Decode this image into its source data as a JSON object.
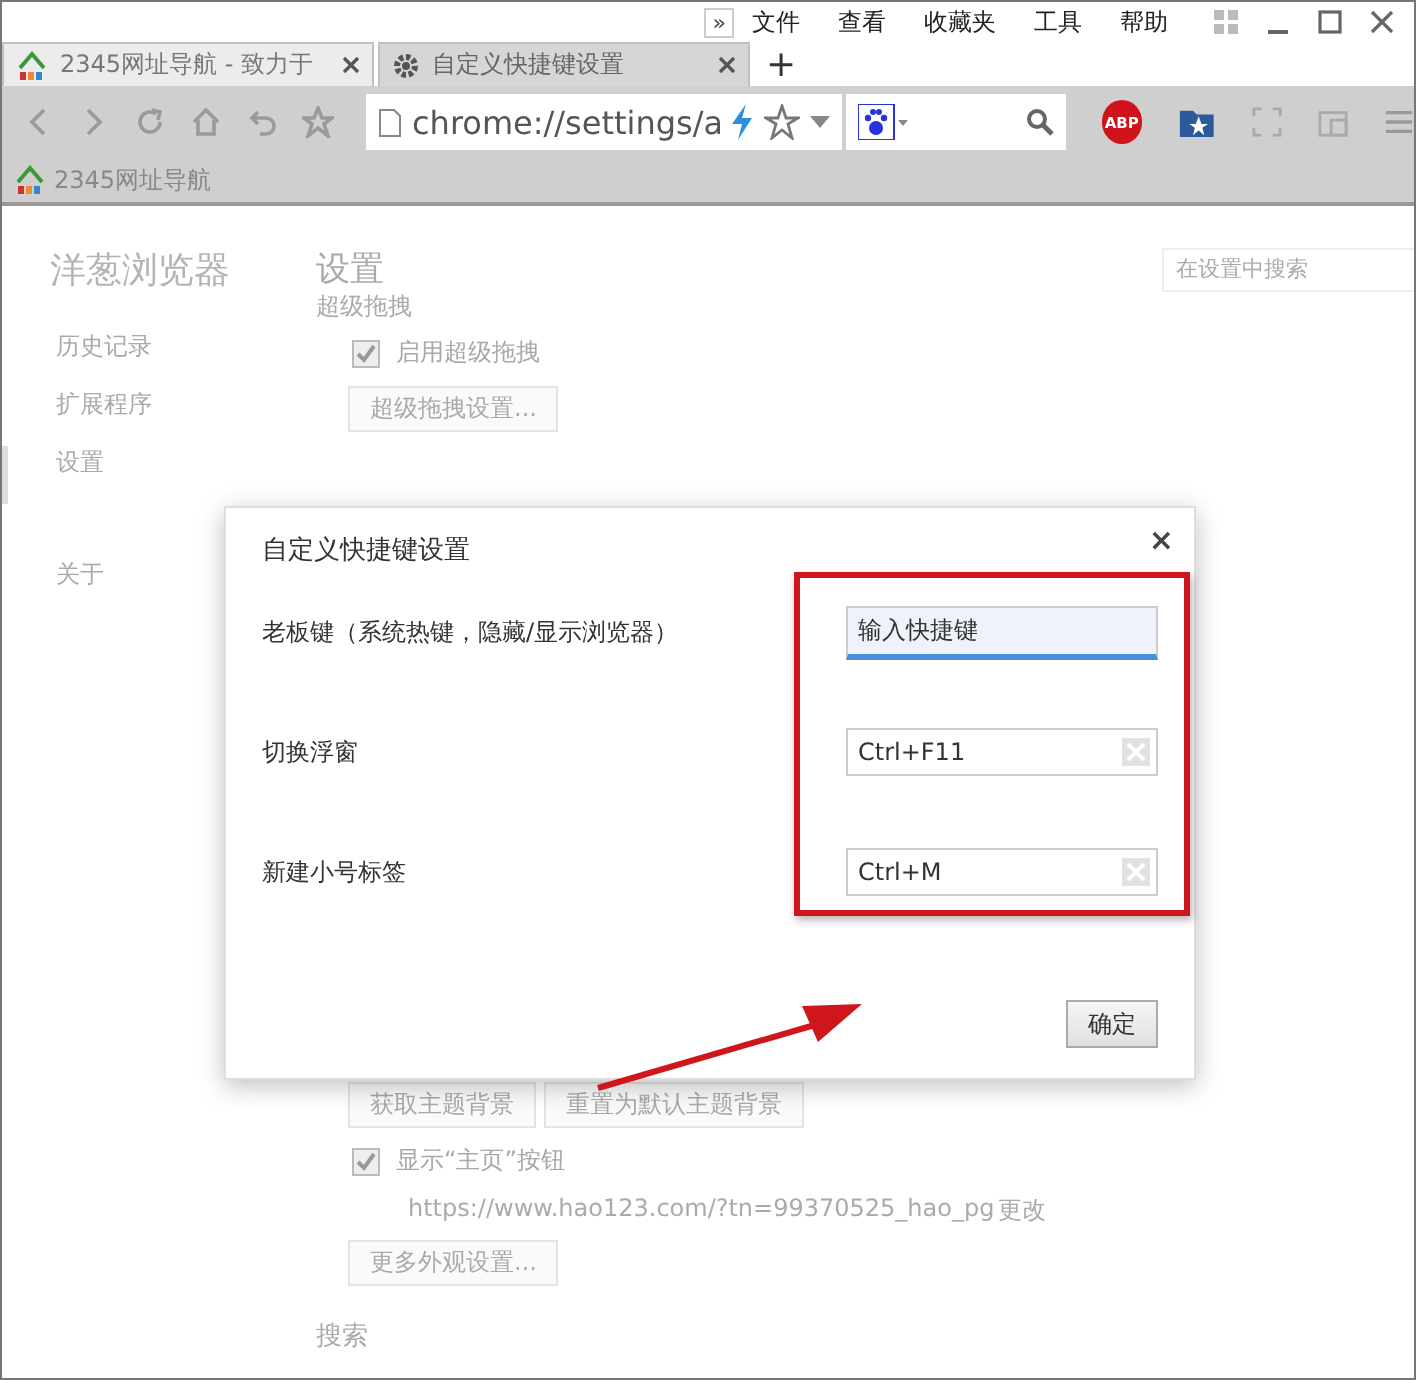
{
  "menu_bar": {
    "overflow": "»",
    "items": [
      "文件",
      "查看",
      "收藏夹",
      "工具",
      "帮助"
    ]
  },
  "tabs": [
    {
      "label": "2345网址导航 - 致力于",
      "selected": true
    },
    {
      "label": "自定义快捷键设置",
      "selected": false
    }
  ],
  "new_tab": "+",
  "address_bar": {
    "value": "chrome://settings/a"
  },
  "adblock_badge": "ABP",
  "bookmarks": [
    {
      "label": "2345网址导航"
    }
  ],
  "sidebar": {
    "title": "洋葱浏览器",
    "items": [
      {
        "label": "历史记录",
        "selected": false
      },
      {
        "label": "扩展程序",
        "selected": false
      },
      {
        "label": "设置",
        "selected": true
      },
      {
        "label": "关于",
        "selected": false
      }
    ]
  },
  "settings": {
    "title": "设置",
    "search_placeholder": "在设置中搜索",
    "section_heading": "超级拖拽",
    "top_items": [
      {
        "kind": "checkbox",
        "label": "启用超级拖拽",
        "checked": true
      },
      {
        "kind": "button",
        "label": "超级拖拽设置..."
      }
    ],
    "bottom_items": [
      {
        "kind": "buttons",
        "labels": [
          "获取主题背景",
          "重置为默认主题背景"
        ]
      },
      {
        "kind": "checkbox",
        "label": "显示“主页”按钮",
        "checked": true
      },
      {
        "kind": "link_line",
        "text": "https://www.hao123.com/?tn=99370525_hao_pg",
        "link": "更改"
      },
      {
        "kind": "button",
        "label": "更多外观设置..."
      }
    ],
    "next_heading": "搜索"
  },
  "dialog": {
    "title": "自定义快捷键设置",
    "close": "×",
    "rows": [
      {
        "label": "老板键（系统热键，隐藏/显示浏览器）",
        "placeholder": "输入快捷键",
        "focused": true
      },
      {
        "label": "切换浮窗",
        "value": "Ctrl+F11",
        "focused": false
      },
      {
        "label": "新建小号标签",
        "value": "Ctrl+M",
        "focused": false
      }
    ],
    "ok_button": "确定"
  }
}
